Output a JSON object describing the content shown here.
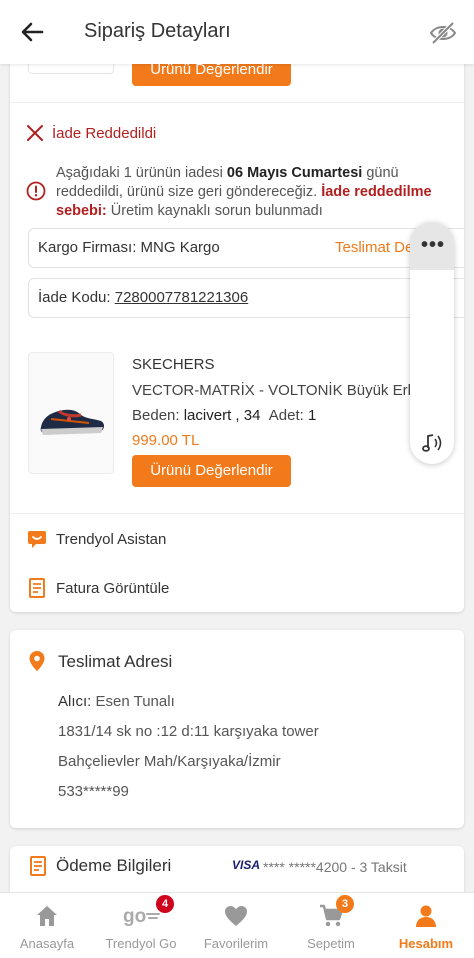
{
  "header": {
    "title": "Sipariş Detayları"
  },
  "order": {
    "top_rate_button": "Ürünü Değerlendir",
    "return_status": "İade Reddedildi",
    "return_msg_pre": "Aşağıdaki 1 ürünün iadesi ",
    "return_msg_date": "06 Mayıs Cumartesi",
    "return_msg_mid": " günü reddedildi, ürünü size geri göndereceğiz. ",
    "return_reason_label": "İade reddedilme sebebi:",
    "return_reason": " Üretim kaynaklı sorun bulunmadı",
    "cargo_label": "Kargo Firması:",
    "cargo_value": "MNG Kargo",
    "delivery_link": "Teslimat Detayları",
    "return_code_label": "İade Kodu:",
    "return_code": "7280007781221306",
    "product": {
      "brand": "SKECHERS",
      "name": "VECTOR-MATRİX - VOLTONİK Büyük Erkek",
      "size_label": "Beden:",
      "size_value": "lacivert , 34",
      "qty_label": "Adet:",
      "qty_value": "1",
      "price": "999.00 TL",
      "rate_button": "Ürünü Değerlendir"
    },
    "assistant": "Trendyol Asistan",
    "invoice": "Fatura Görüntüle"
  },
  "address": {
    "title": "Teslimat Adresi",
    "recipient_label": "Alıcı:",
    "recipient": "Esen Tunalı",
    "line1": "1831/14 sk no :12 d:11 karşıyaka tower",
    "line2": "Bahçelievler Mah/Karşıyaka/İzmir",
    "phone": "533*****99"
  },
  "payment": {
    "title": "Ödeme Bilgileri",
    "card_brand": "VISA",
    "card_info": "**** *****4200 - 3 Taksit"
  },
  "nav": {
    "items": [
      {
        "label": "Anasayfa",
        "icon": "home-icon"
      },
      {
        "label": "Trendyol Go",
        "icon": "go-icon",
        "badge": "4"
      },
      {
        "label": "Favorilerim",
        "icon": "heart-icon"
      },
      {
        "label": "Sepetim",
        "icon": "cart-icon",
        "badge": "3"
      },
      {
        "label": "Hesabım",
        "icon": "person-icon"
      }
    ]
  },
  "colors": {
    "accent": "#f27a1a",
    "danger": "#b21f1f",
    "badge_red": "#d0021b"
  }
}
